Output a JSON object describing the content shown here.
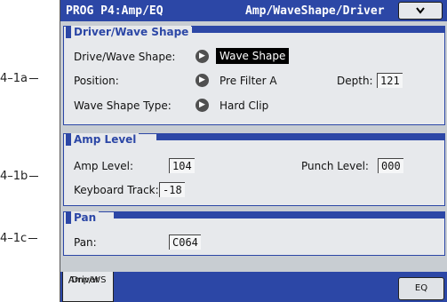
{
  "callouts": [
    "4–1a",
    "4–1b",
    "4–1c"
  ],
  "titlebar": {
    "page": "PROG P4:Amp/EQ",
    "subpage": "Amp/WaveShape/Driver",
    "menu_icon": "chevron-down-icon"
  },
  "driver_section": {
    "title": "Driver/Wave Shape",
    "drive_label": "Drive/Wave Shape:",
    "drive_value": "Wave Shape",
    "position_label": "Position:",
    "position_value": "Pre Filter A",
    "depth_label": "Depth:",
    "depth_value": "121",
    "type_label": "Wave Shape Type:",
    "type_value": "Hard Clip"
  },
  "amp_section": {
    "title": "Amp Level",
    "amp_label": "Amp Level:",
    "amp_value": "104",
    "punch_label": "Punch Level:",
    "punch_value": "000",
    "kbd_label": "Keyboard Track:",
    "kbd_value": "-18"
  },
  "pan_section": {
    "title": "Pan",
    "pan_label": "Pan:",
    "pan_value": "C064"
  },
  "tabs": {
    "amp_line1": "Amp/WS",
    "amp_line2": "/Driver",
    "eq": "EQ"
  },
  "colors": {
    "accent": "#2c47a6",
    "panel": "#c8cdd2",
    "section": "#e7e9ec"
  }
}
